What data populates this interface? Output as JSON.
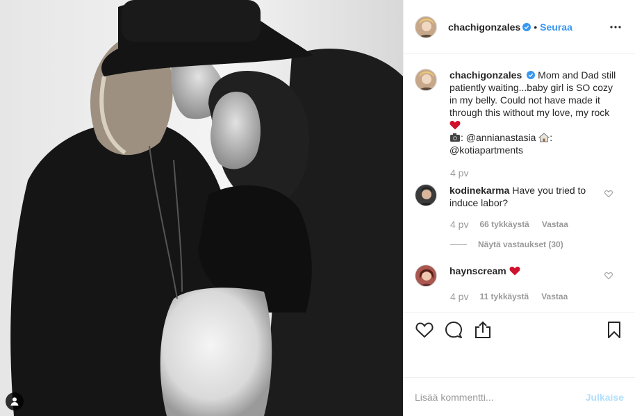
{
  "header": {
    "username": "chachigonzales",
    "separator": "•",
    "follow_label": "Seuraa"
  },
  "caption": {
    "username": "chachigonzales",
    "text_1": "Mom and Dad still patiently waiting...baby girl is SO cozy in my belly. Could not have made it through this without my love, my rock",
    "credit_photo": ": @annianastasia",
    "credit_home": ":",
    "credit_home_handle": "@kotiapartments",
    "time": "4 pv"
  },
  "comments": [
    {
      "username": "kodinekarma",
      "text": "Have you tried to induce labor?",
      "time": "4 pv",
      "likes": "66 tykkäystä",
      "reply": "Vastaa",
      "view_replies": "Näytä vastaukset (30)"
    },
    {
      "username": "haynscream",
      "text": "",
      "time": "4 pv",
      "likes": "11 tykkäystä",
      "reply": "Vastaa"
    }
  ],
  "add_comment": {
    "placeholder": "Lisää kommentti...",
    "post_label": "Julkaise"
  },
  "colors": {
    "link_blue": "#3897f0",
    "verified_blue": "#3897f0",
    "heart_red": "#ed4956",
    "muted": "#999999"
  },
  "icons": [
    "user-tag-icon",
    "verified-badge-icon",
    "more-options-icon",
    "heart-icon",
    "comment-icon",
    "share-icon",
    "bookmark-icon",
    "camera-emoji-icon",
    "house-emoji-icon",
    "red-heart-emoji-icon"
  ]
}
